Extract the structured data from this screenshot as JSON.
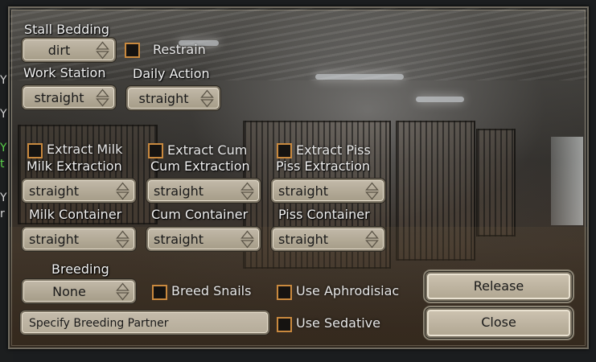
{
  "background_letters": [
    {
      "text": "Y",
      "color": "#d8d8d8"
    },
    {
      "text": "Y",
      "color": "#d8d8d8"
    },
    {
      "text": "Y",
      "color": "#5bd24a"
    },
    {
      "text": "t",
      "color": "#5bd24a"
    },
    {
      "text": "Y",
      "color": "#d8d8d8"
    },
    {
      "text": "r",
      "color": "#d8d8d8"
    }
  ],
  "stall_bedding": {
    "label": "Stall Bedding",
    "value": "dirt"
  },
  "restrain": {
    "label": "Restrain",
    "checked": false
  },
  "work_station": {
    "label": "Work Station",
    "value": "straight"
  },
  "daily_action": {
    "label": "Daily Action",
    "value": "straight"
  },
  "extract": {
    "milk": {
      "label": "Extract Milk",
      "checked": false
    },
    "cum": {
      "label": "Extract Cum",
      "checked": false
    },
    "piss": {
      "label": "Extract Piss",
      "checked": false
    }
  },
  "extraction": {
    "milk": {
      "label": "Milk Extraction",
      "value": "straight"
    },
    "cum": {
      "label": "Cum Extraction",
      "value": "straight"
    },
    "piss": {
      "label": "Piss Extraction",
      "value": "straight"
    }
  },
  "container": {
    "milk": {
      "label": "Milk Container",
      "value": "straight"
    },
    "cum": {
      "label": "Cum Container",
      "value": "straight"
    },
    "piss": {
      "label": "Piss Container",
      "value": "straight"
    }
  },
  "breeding": {
    "label": "Breeding",
    "value": "None"
  },
  "breed_snails": {
    "label": "Breed Snails",
    "checked": false
  },
  "use_aphrodisiac": {
    "label": "Use Aphrodisiac",
    "checked": false
  },
  "use_sedative": {
    "label": "Use Sedative",
    "checked": false
  },
  "specify_partner": {
    "label": "Specify Breeding Partner"
  },
  "buttons": {
    "release": "Release",
    "close": "Close"
  },
  "colors": {
    "accent_checkbox": "#c9893e",
    "field_bg": "#b8af9c",
    "panel_border": "#6f6a5f"
  }
}
